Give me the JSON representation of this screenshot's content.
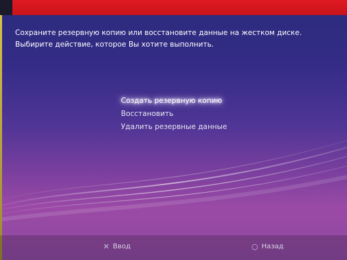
{
  "header": {
    "accent_color": "#e01922"
  },
  "message": {
    "line1": "Сохраните резервную копию или восстановите данные на жестком диске.",
    "line2": "Выбирите действие, которое Вы хотите выполнить."
  },
  "menu": {
    "items": [
      {
        "label": "Создать резервную копию",
        "selected": true
      },
      {
        "label": "Восстановить",
        "selected": false
      },
      {
        "label": "Удалить резервные данные",
        "selected": false
      }
    ]
  },
  "footer": {
    "enter": {
      "icon": "cross-icon",
      "glyph": "✕",
      "label": "Ввод"
    },
    "back": {
      "icon": "circle-icon",
      "glyph": "○",
      "label": "Назад"
    }
  }
}
